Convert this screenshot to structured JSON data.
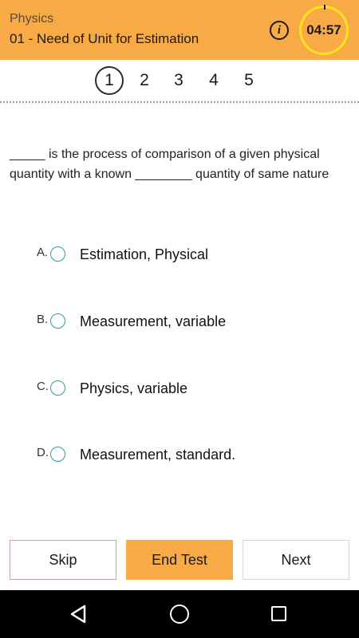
{
  "header": {
    "subject": "Physics",
    "chapter": "01 - Need of Unit for Estimation",
    "info_icon": "info-icon",
    "timer": "04:57",
    "color": "#f8aa47",
    "timer_ring_color": "#ffe21f"
  },
  "question_nav": {
    "numbers": [
      "1",
      "2",
      "3",
      "4",
      "5"
    ],
    "active_index": 0
  },
  "question": {
    "text": "_____ is the process of comparison of a given physical quantity with a known ________ quantity of same nature"
  },
  "options": [
    {
      "letter": "A.",
      "text": "Estimation, Physical"
    },
    {
      "letter": "B.",
      "text": "Measurement, variable"
    },
    {
      "letter": "C.",
      "text": "Physics, variable"
    },
    {
      "letter": "D.",
      "text": "Measurement, standard."
    }
  ],
  "buttons": {
    "skip": "Skip",
    "end_test": "End Test",
    "next": "Next"
  },
  "system_nav": {
    "back_icon": "back-triangle-icon",
    "home_icon": "home-circle-icon",
    "recents_icon": "recents-square-icon"
  }
}
